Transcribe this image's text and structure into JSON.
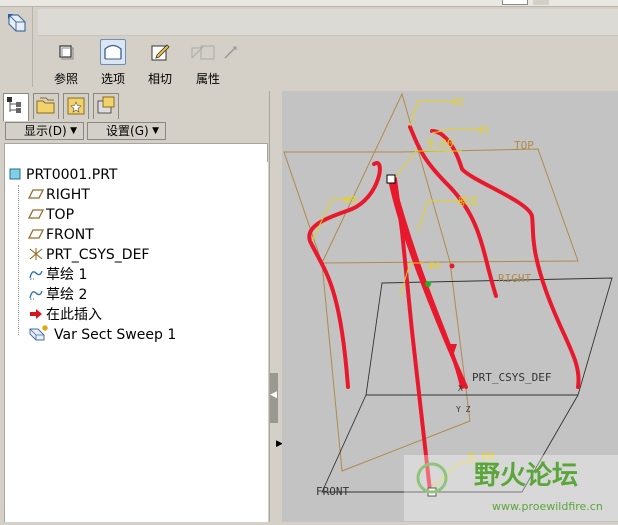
{
  "dashboard": {
    "tabs": [
      {
        "label": "参照",
        "icon": "reference-icon"
      },
      {
        "label": "选项",
        "icon": "options-icon"
      },
      {
        "label": "相切",
        "icon": "tangency-icon"
      },
      {
        "label": "属性",
        "icon": "properties-icon"
      }
    ],
    "active_tab": "选项"
  },
  "tree": {
    "show_button": "显示",
    "show_key": "(D)",
    "settings_button": "设置",
    "settings_key": "(G)",
    "root": "PRT0001.PRT",
    "items": [
      {
        "label": "RIGHT",
        "icon": "datum-plane-icon"
      },
      {
        "label": "TOP",
        "icon": "datum-plane-icon"
      },
      {
        "label": "FRONT",
        "icon": "datum-plane-icon"
      },
      {
        "label": "PRT_CSYS_DEF",
        "icon": "csys-icon"
      },
      {
        "label": "草绘 1",
        "icon": "sketch-icon"
      },
      {
        "label": "草绘 2",
        "icon": "sketch-icon"
      },
      {
        "label": "在此插入",
        "icon": "insert-here-arrow-icon"
      },
      {
        "label": "Var Sect Sweep 1",
        "icon": "var-sect-sweep-icon"
      }
    ]
  },
  "graphics": {
    "labels": {
      "top": "TOP",
      "right": "RIGHT",
      "front": "FRONT",
      "csys": "PRT_CSYS_DEF",
      "csys_axes": "Y Z",
      "csys_x": "X",
      "dim_top": "0.00",
      "dim_bottom": "0.00",
      "chain2": "#2",
      "chain1": "#1",
      "chain3": "#3",
      "origin": "原点",
      "chain4": "#4"
    },
    "curve_color": "#e8192c",
    "datum_color": "#b08a4a"
  },
  "watermark": {
    "title": "野火论坛",
    "url": "www.proewildfire.cn"
  }
}
